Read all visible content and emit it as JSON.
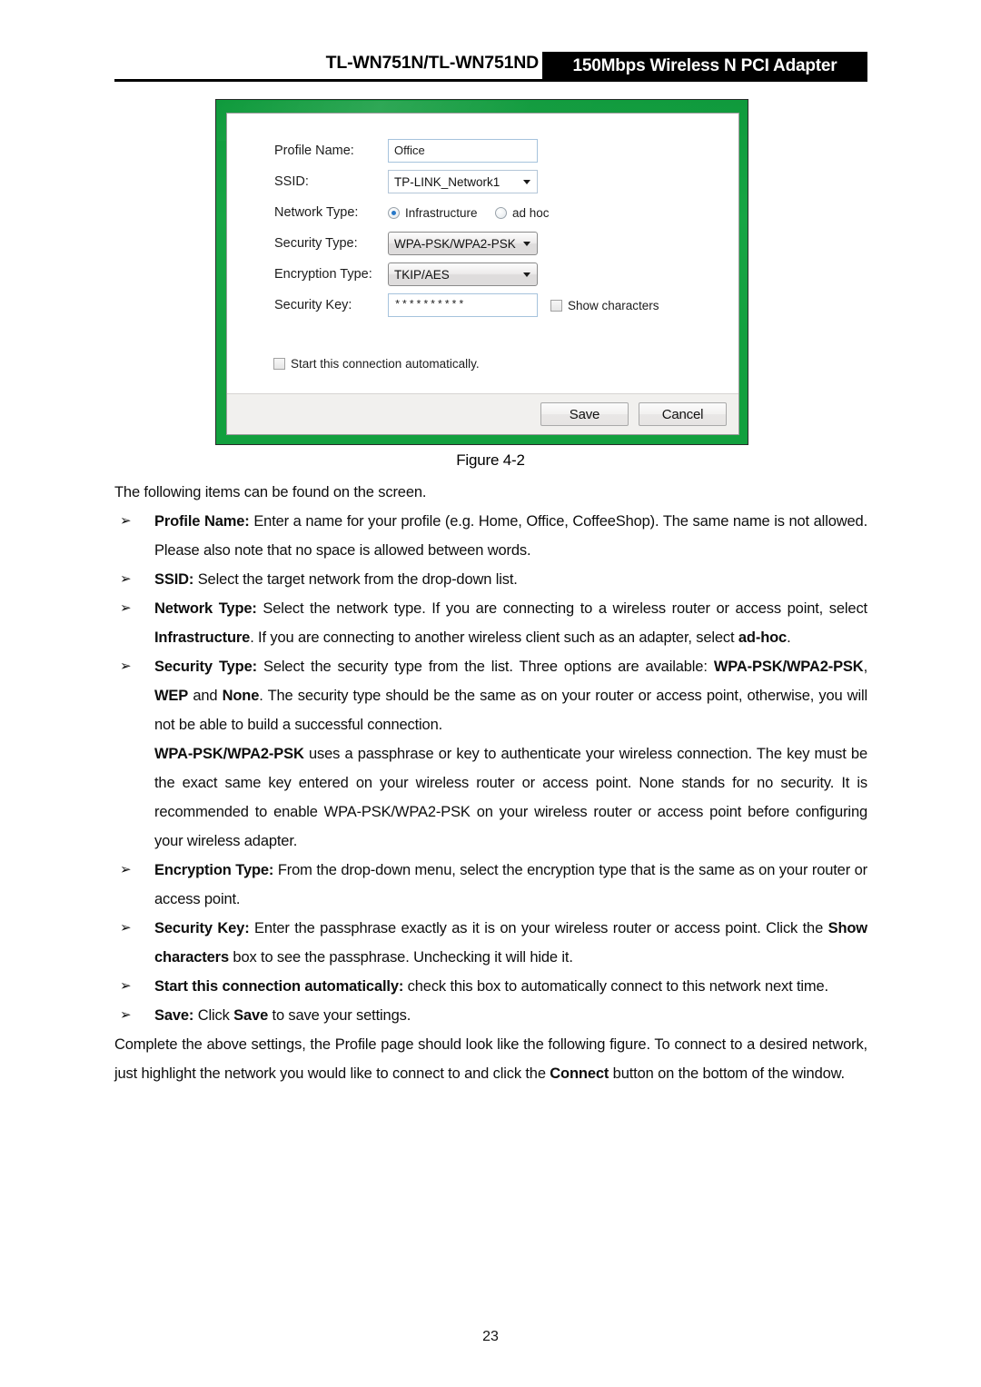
{
  "header": {
    "model_title": "TL-WN751N/TL-WN751ND",
    "badge_title": "150Mbps Wireless N PCI Adapter"
  },
  "dialog": {
    "fields": {
      "profile_name": {
        "label": "Profile Name:",
        "value": "Office"
      },
      "ssid": {
        "label": "SSID:",
        "value": "TP-LINK_Network1"
      },
      "network_type": {
        "label": "Network Type:",
        "options": [
          {
            "label": "Infrastructure",
            "selected": true
          },
          {
            "label": "ad hoc",
            "selected": false
          }
        ]
      },
      "security_type": {
        "label": "Security Type:",
        "value": "WPA-PSK/WPA2-PSK"
      },
      "encryption_type": {
        "label": "Encryption Type:",
        "value": "TKIP/AES"
      },
      "security_key": {
        "label": "Security Key:",
        "value": "**********"
      }
    },
    "show_characters": {
      "label": "Show characters",
      "checked": false
    },
    "start_automatically": {
      "label": "Start this connection automatically.",
      "checked": false
    },
    "buttons": {
      "save": "Save",
      "cancel": "Cancel"
    },
    "colors": {
      "frame_green": "#12a03e",
      "accent_blue": "#2878c8"
    }
  },
  "figure_caption": "Figure 4-2",
  "body": {
    "intro": "The following items can be found on the screen.",
    "bullet_glyph": "➢",
    "items": {
      "profile_name": {
        "term": "Profile Name:",
        "text": " Enter a name for your profile (e.g. Home, Office, CoffeeShop). The same name is not allowed. Please also note that no space is allowed between words."
      },
      "ssid": {
        "term": "SSID:",
        "text": " Select the target network from the drop-down list."
      },
      "network_type": {
        "term": "Network Type:",
        "t1": " Select the network type. If you are connecting to a wireless router or access point, select ",
        "b1": "Infrastructure",
        "t2": ". If you are connecting to another wireless client such as an adapter, select ",
        "b2": "ad-hoc",
        "t3": "."
      },
      "security_type": {
        "term": "Security Type:",
        "t1": " Select the security type from the list. Three options are available: ",
        "b1": "WPA-PSK/WPA2-PSK",
        "t2": ", ",
        "b2": "WEP",
        "t3": " and ",
        "b3": "None",
        "t4": ". The security type should be the same as on your router or access point, otherwise, you will not be able to build a successful connection.",
        "p2_b1": "WPA-PSK/WPA2-PSK",
        "p2_t1": " uses a passphrase or key to authenticate your wireless connection. The key must be the exact same key entered on your wireless router or access point. None stands for no security. It is recommended to enable WPA-PSK/WPA2-PSK on your wireless router or access point before configuring your wireless adapter."
      },
      "encryption_type": {
        "term": "Encryption Type:",
        "text": " From the drop-down menu, select the encryption type that is the same as on your router or access point."
      },
      "security_key": {
        "term": "Security Key:",
        "t1": " Enter the passphrase exactly as it is on your wireless router or access point. Click the ",
        "b1": "Show characters",
        "t2": " box to see the passphrase. Unchecking it will hide it."
      },
      "start_auto": {
        "term": "Start this connection automatically:",
        "text": " check this box to automatically connect to this network next time."
      },
      "save": {
        "term": "Save:",
        "t1": " Click ",
        "b1": "Save",
        "t2": " to save your settings."
      }
    },
    "closing": {
      "t1": "Complete the above settings, the Profile page should look like the following figure. To connect to a desired network, just highlight the network you would like to connect to and click the ",
      "b1": "Connect",
      "t2": " button on the bottom of the window."
    }
  },
  "page_number": "23"
}
